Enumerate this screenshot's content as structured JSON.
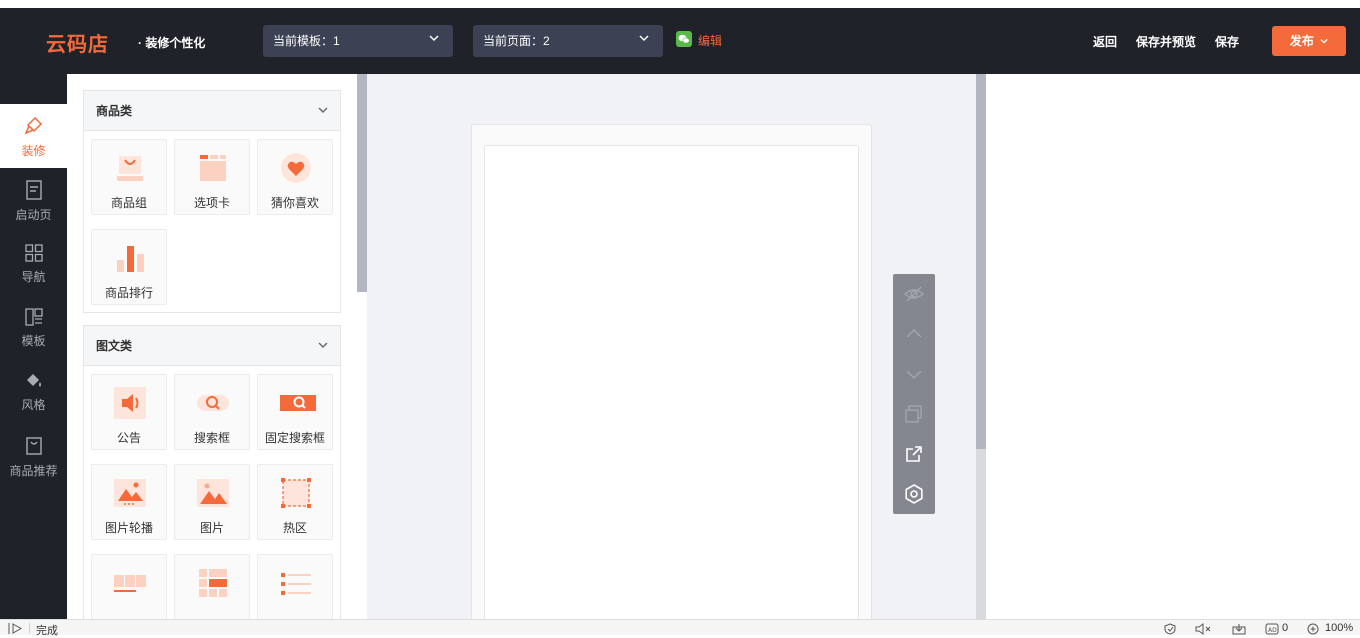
{
  "header": {
    "logo": "云码店",
    "title": "· 装修个性化",
    "template_select": "当前模板：1",
    "page_select": "当前页面：2",
    "edit_link": "编辑",
    "back": "返回",
    "save_preview": "保存并预览",
    "save": "保存",
    "publish": "发布"
  },
  "sidebar": {
    "items": [
      {
        "label": "装修",
        "icon": "brush-icon"
      },
      {
        "label": "启动页",
        "icon": "document-icon"
      },
      {
        "label": "导航",
        "icon": "grid-icon"
      },
      {
        "label": "模板",
        "icon": "template-icon"
      },
      {
        "label": "风格",
        "icon": "paint-bucket-icon"
      },
      {
        "label": "商品推荐",
        "icon": "bag-icon"
      }
    ]
  },
  "panel": {
    "sections": [
      {
        "title": "商品类",
        "items": [
          "商品组",
          "选项卡",
          "猜你喜欢",
          "商品排行"
        ]
      },
      {
        "title": "图文类",
        "items": [
          "公告",
          "搜索框",
          "固定搜索框",
          "图片轮播",
          "图片",
          "热区"
        ]
      }
    ]
  },
  "status": {
    "text": "完成",
    "count": "0",
    "zoom": "100%"
  },
  "colors": {
    "accent": "#f46a3a",
    "header_bg": "#1f2329",
    "select_bg": "#3c4254",
    "toolbar_bg": "#858790"
  }
}
